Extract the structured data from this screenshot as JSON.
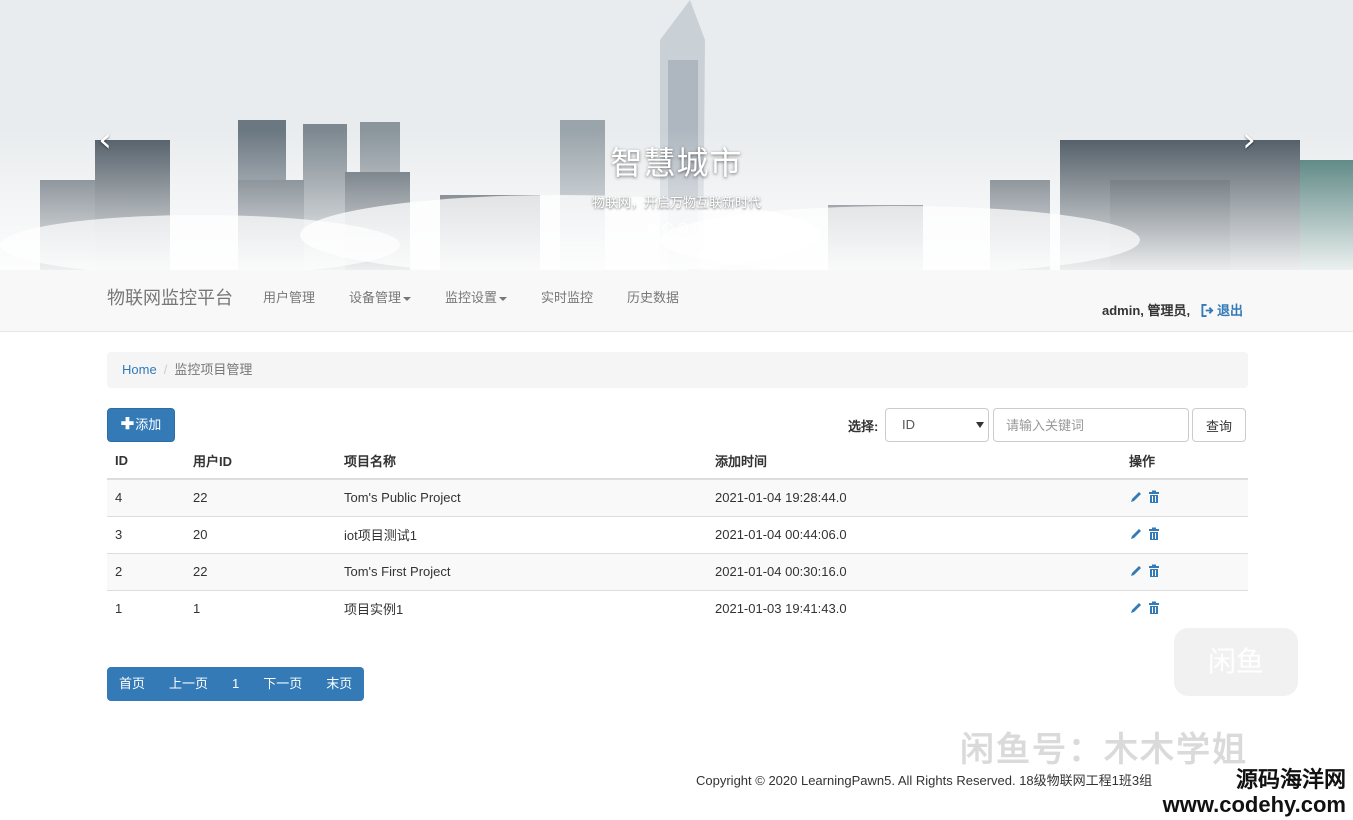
{
  "carousel": {
    "title": "智慧城市",
    "subtitle": "物联网，开启万物互联新时代",
    "indicators": 4,
    "active_index": 0
  },
  "navbar": {
    "brand": "物联网监控平台",
    "items": [
      {
        "label": "用户管理",
        "dropdown": false
      },
      {
        "label": "设备管理",
        "dropdown": true
      },
      {
        "label": "监控设置",
        "dropdown": true
      },
      {
        "label": "实时监控",
        "dropdown": false
      },
      {
        "label": "历史数据",
        "dropdown": false
      }
    ],
    "user": "admin, 管理员,",
    "logout": "退出"
  },
  "breadcrumb": {
    "home": "Home",
    "current": "监控项目管理"
  },
  "toolbar": {
    "add_label": "添加",
    "search_label": "选择:",
    "search_select_value": "ID",
    "search_placeholder": "请输入关键词",
    "query_label": "查询"
  },
  "table": {
    "headers": [
      "ID",
      "用户ID",
      "项目名称",
      "添加时间",
      "操作"
    ],
    "rows": [
      {
        "id": "4",
        "uid": "22",
        "name": "Tom's Public Project",
        "time": "2021-01-04 19:28:44.0"
      },
      {
        "id": "3",
        "uid": "20",
        "name": "iot项目测试1",
        "time": "2021-01-04 00:44:06.0"
      },
      {
        "id": "2",
        "uid": "22",
        "name": "Tom's First Project",
        "time": "2021-01-04 00:30:16.0"
      },
      {
        "id": "1",
        "uid": "1",
        "name": "项目实例1",
        "time": "2021-01-03 19:41:43.0"
      }
    ]
  },
  "pagination": {
    "first": "首页",
    "prev": "上一页",
    "current": "1",
    "next": "下一页",
    "last": "末页"
  },
  "footer": {
    "copyright": "Copyright © 2020 LearningPawn5. All Rights Reserved. 18级物联网工程1班3组"
  },
  "watermark": {
    "text1": "闲鱼号：木木学姐",
    "badge": "闲鱼",
    "site_cn": "源码海洋网",
    "site_url": "www.codehy.com"
  },
  "colors": {
    "primary": "#337ab7",
    "navbar_bg": "#f8f8f8",
    "breadcrumb_bg": "#f5f5f5"
  }
}
